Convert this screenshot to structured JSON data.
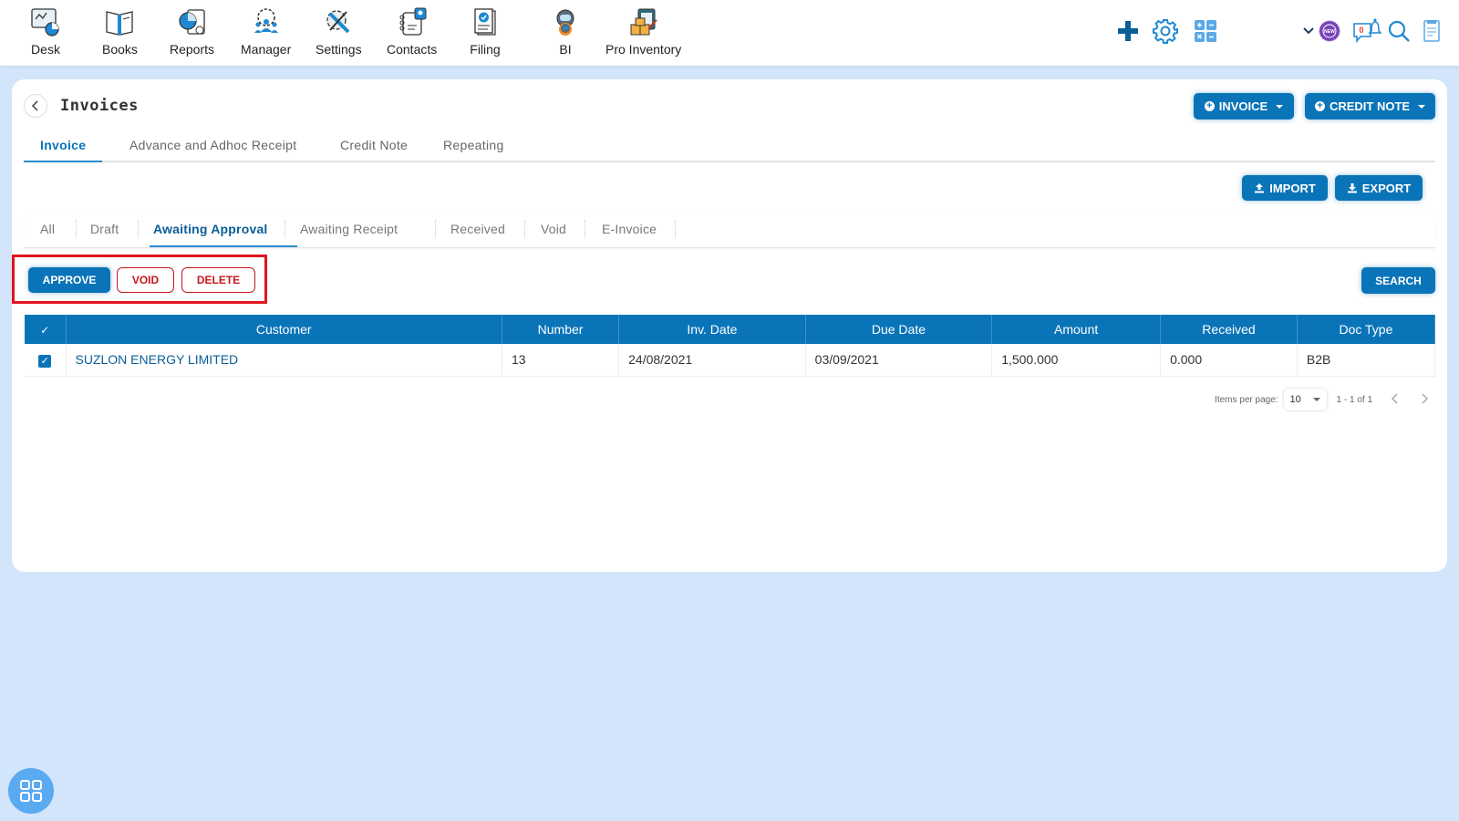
{
  "nav": {
    "items": [
      {
        "label": "Desk",
        "icon": "desk-icon"
      },
      {
        "label": "Books",
        "icon": "books-icon"
      },
      {
        "label": "Reports",
        "icon": "reports-icon"
      },
      {
        "label": "Manager",
        "icon": "manager-icon"
      },
      {
        "label": "Settings",
        "icon": "settings-tools-icon"
      },
      {
        "label": "Contacts",
        "icon": "contacts-icon"
      },
      {
        "label": "Filing",
        "icon": "filing-icon"
      },
      {
        "label": "BI",
        "icon": "bi-robot-icon"
      },
      {
        "label": "Pro Inventory",
        "icon": "pro-inventory-icon"
      }
    ],
    "right_icons": [
      "plus-icon",
      "gear-icon",
      "calculator-icon",
      "chevron-down-icon",
      "new-badge-icon",
      "notification-icon",
      "search-icon",
      "document-icon"
    ],
    "notification_count": "0",
    "new_badge_text": "NEW"
  },
  "page": {
    "title": "Invoices",
    "invoice_button": "INVOICE",
    "credit_note_button": "CREDIT NOTE",
    "import_button": "IMPORT",
    "export_button": "EXPORT",
    "search_button": "SEARCH"
  },
  "main_tabs": [
    {
      "label": "Invoice",
      "active": true
    },
    {
      "label": "Advance and Adhoc Receipt",
      "active": false
    },
    {
      "label": "Credit Note",
      "active": false
    },
    {
      "label": "Repeating",
      "active": false
    }
  ],
  "status_tabs": [
    {
      "label": "All",
      "active": false
    },
    {
      "label": "Draft",
      "active": false
    },
    {
      "label": "Awaiting Approval",
      "active": true
    },
    {
      "label": "Awaiting Receipt",
      "active": false
    },
    {
      "label": "Received",
      "active": false
    },
    {
      "label": "Void",
      "active": false
    },
    {
      "label": "E-Invoice",
      "active": false
    }
  ],
  "actions": {
    "approve": "APPROVE",
    "void": "VOID",
    "delete": "DELETE"
  },
  "table": {
    "columns": [
      "Customer",
      "Number",
      "Inv. Date",
      "Due Date",
      "Amount",
      "Received",
      "Doc Type"
    ],
    "rows": [
      {
        "checked": true,
        "customer": "SUZLON ENERGY LIMITED",
        "number": "13",
        "inv_date": "24/08/2021",
        "due_date": "03/09/2021",
        "amount": "1,500.000",
        "received": "0.000",
        "doc_type": "B2B"
      }
    ]
  },
  "pagination": {
    "items_per_page_label": "Items per page:",
    "items_per_page": "10",
    "range": "1 - 1 of 1"
  },
  "colors": {
    "primary": "#0a74b8",
    "danger": "#c8171e",
    "background": "#d3e5fb"
  }
}
